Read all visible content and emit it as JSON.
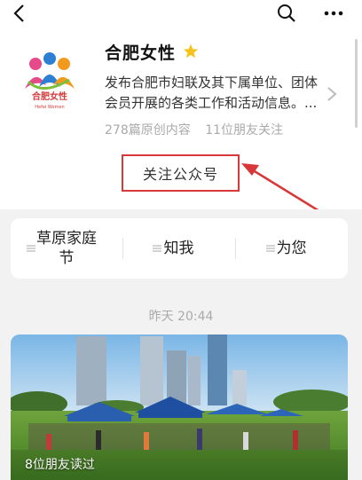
{
  "topbar": {
    "back_icon": "chevron-left-icon",
    "search_icon": "search-icon",
    "more_icon": "more-dots-icon"
  },
  "account": {
    "name": "合肥女性",
    "star_icon": "star-icon",
    "star_color": "#f7c31b",
    "logo_text": "合肥女性",
    "logo_subtext": "Hefei Women",
    "description_line1": "发布合肥市妇联及其下属单位、团体",
    "description_line2": "会员开展的各类工作和活动信息。...",
    "original_count": "278篇原创内容",
    "friends_following": "11位朋友关注",
    "follow_button": "关注公众号"
  },
  "annotation": {
    "color": "#d9383a"
  },
  "menu": {
    "items": [
      {
        "label_line1": "草原家庭",
        "label_line2": "节"
      },
      {
        "label_line1": "知我",
        "label_line2": ""
      },
      {
        "label_line1": "为您",
        "label_line2": ""
      }
    ]
  },
  "feed": {
    "timestamp": "昨天 20:44",
    "article": {
      "friends_read": "8位朋友读过"
    }
  }
}
